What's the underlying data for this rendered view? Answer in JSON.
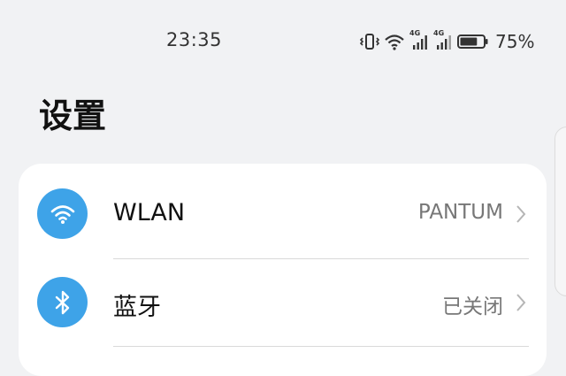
{
  "status_bar": {
    "time": "23:35",
    "battery_percent": "75%",
    "network_1": "4G",
    "network_2": "4G",
    "icons": [
      "vibrate-icon",
      "wifi-icon",
      "signal-4g-icon",
      "signal-4g-icon",
      "battery-icon"
    ],
    "battery_level": 0.75
  },
  "header": {
    "title": "设置"
  },
  "settings": [
    {
      "label": "WLAN",
      "value": "PANTUM",
      "icon": "wifi-icon"
    },
    {
      "label": "蓝牙",
      "value": "已关闭",
      "icon": "bluetooth-icon"
    }
  ],
  "colors": {
    "accent": "#3ea3e8",
    "background": "#f1f2f4",
    "card": "#ffffff"
  }
}
